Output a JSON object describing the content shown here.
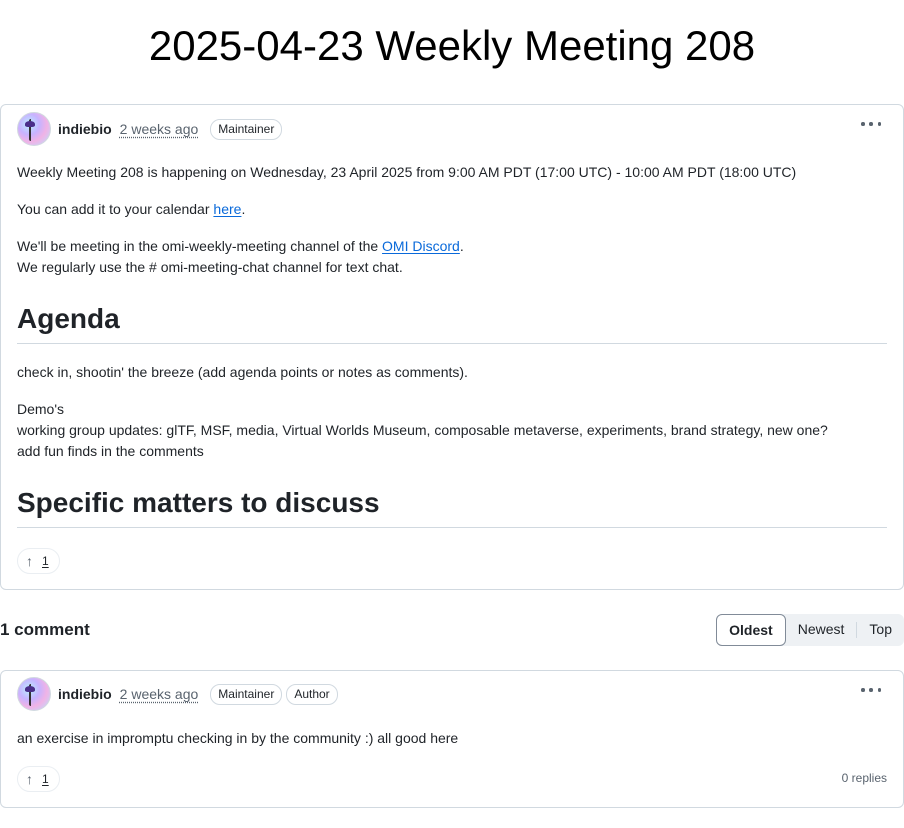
{
  "page": {
    "title": "2025-04-23 Weekly Meeting 208"
  },
  "post": {
    "author": "indiebio",
    "time": "2 weeks ago",
    "badges": [
      "Maintainer"
    ],
    "more_label": "More options",
    "paragraph1": "Weekly Meeting 208 is happening on Wednesday, 23 April 2025 from 9:00 AM PDT (17:00 UTC) - 10:00 AM PDT (18:00 UTC)",
    "paragraph2_prefix": "You can add it to your calendar ",
    "paragraph2_link": "here",
    "paragraph2_suffix": ".",
    "paragraph3_prefix": "We'll be meeting in the omi-weekly-meeting channel of the ",
    "paragraph3_link": "OMI Discord",
    "paragraph3_suffix": ".",
    "paragraph3_line2": "We regularly use the # omi-meeting-chat channel for text chat.",
    "heading_agenda": "Agenda",
    "agenda_line1": "check in, shootin' the breeze (add agenda points or notes as comments).",
    "agenda_line2": "Demo's",
    "agenda_line3": "working group updates: glTF, MSF, media, Virtual Worlds Museum, composable metaverse, experiments, brand strategy, new one?",
    "agenda_line4": "add fun finds in the comments",
    "heading_matters": "Specific matters to discuss",
    "upvotes": "1"
  },
  "comments": {
    "count_label": "1 comment",
    "sort_options": [
      "Oldest",
      "Newest",
      "Top"
    ],
    "sort_selected": "Oldest",
    "items": [
      {
        "author": "indiebio",
        "time": "2 weeks ago",
        "badges": [
          "Maintainer",
          "Author"
        ],
        "text": "an exercise in impromptu checking in by the community :) all good here",
        "upvotes": "1",
        "replies": "0 replies"
      }
    ]
  },
  "icons": {
    "upvote": "arrow-up-icon",
    "more": "kebab-horizontal-icon",
    "avatar": "user-avatar"
  }
}
